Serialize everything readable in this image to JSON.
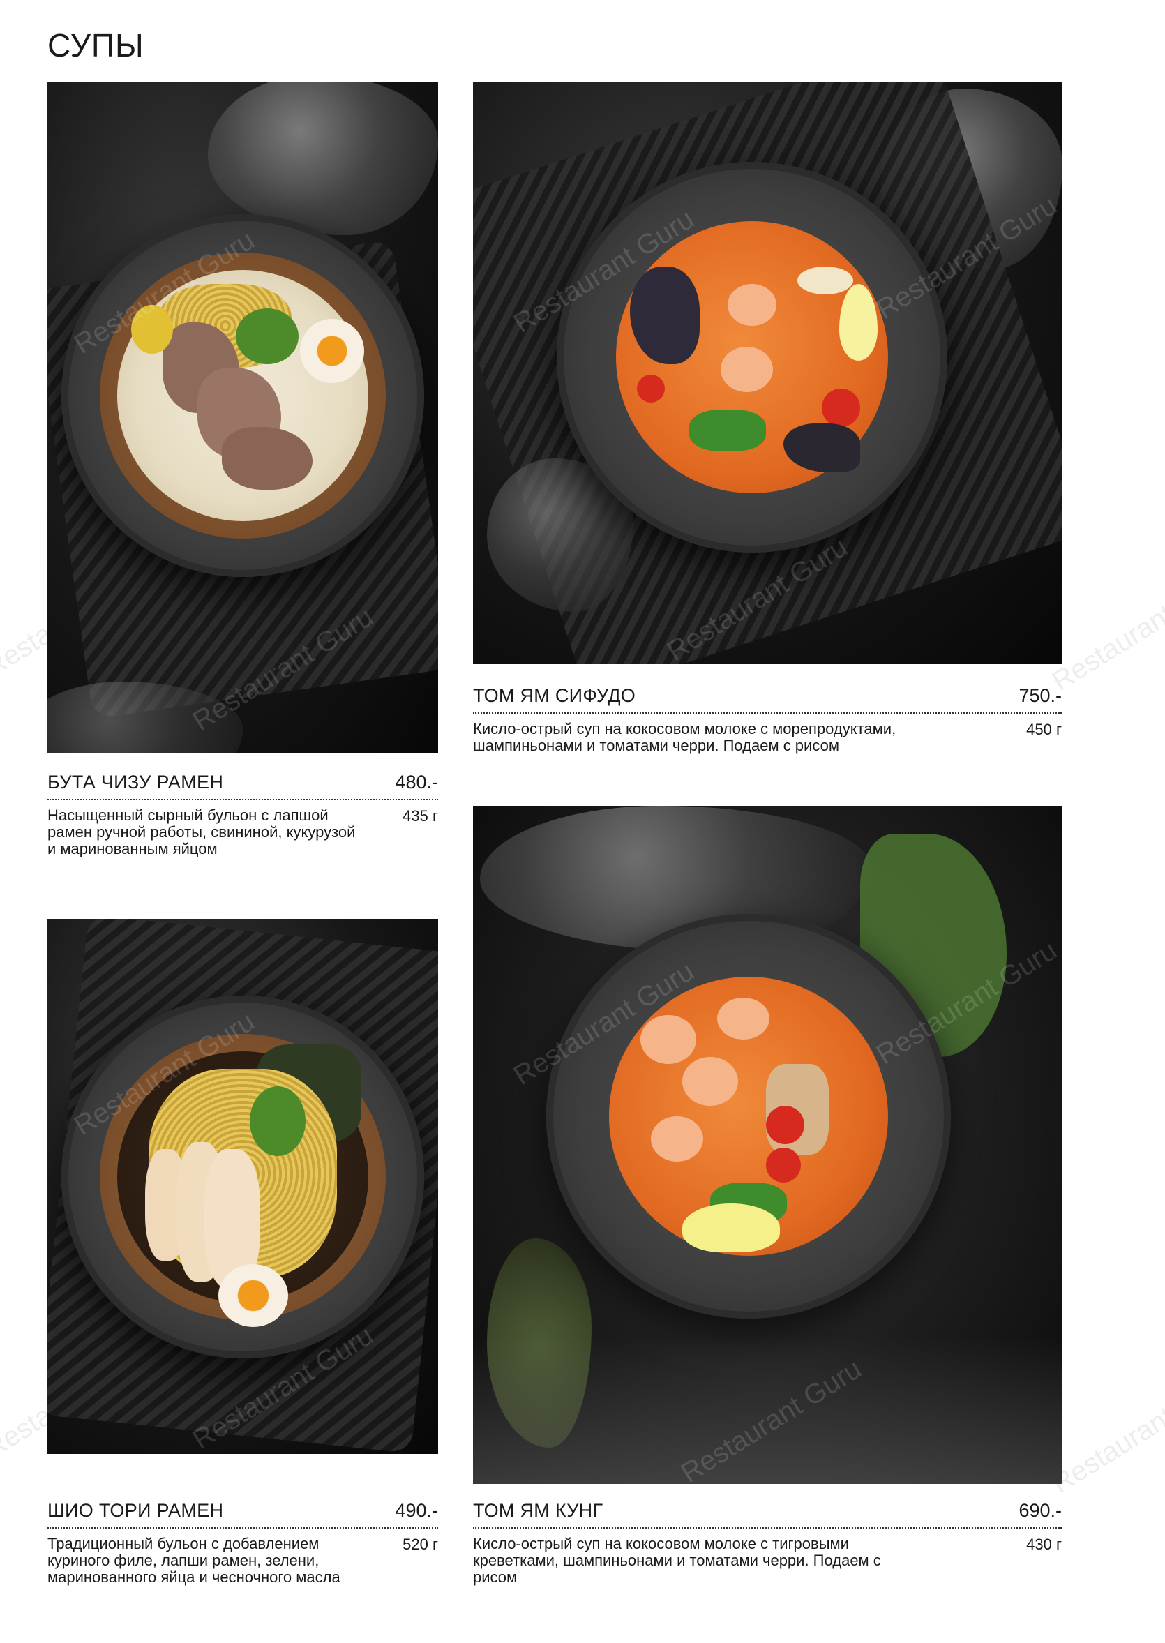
{
  "page": {
    "title": "СУПЫ",
    "watermark": "Restaurant Guru"
  },
  "items": [
    {
      "name": "БУТА ЧИЗУ РАМЕН",
      "price": "480.-",
      "weight": "435 г",
      "description": "Насыщенный сырный бульон с лапшой рамен ручной работы, свининой, кукурузой и маринованным яйцом"
    },
    {
      "name": "ТОМ ЯМ СИФУДО",
      "price": "750.-",
      "weight": "450 г",
      "description": "Кисло-острый суп на кокосовом молоке с морепродуктами, шампиньонами и томатами черри. Подаем с рисом"
    },
    {
      "name": "ШИО ТОРИ РАМЕН",
      "price": "490.-",
      "weight": "520 г",
      "description": "Традиционный бульон с добавлением куриного филе, лапши рамен, зелени, маринованного яйца и чесночного масла"
    },
    {
      "name": "ТОМ ЯМ КУНГ",
      "price": "690.-",
      "weight": "430 г",
      "description": "Кисло-острый суп на кокосовом молоке с тигровыми креветками, шампиньонами и томатами черри. Подаем с рисом"
    }
  ]
}
